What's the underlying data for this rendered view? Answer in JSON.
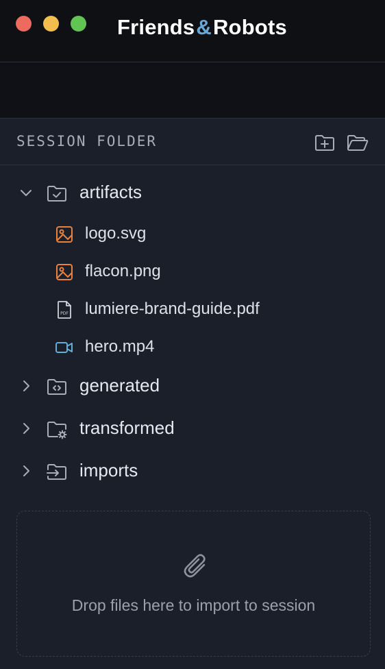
{
  "app": {
    "brand_left": "Friends",
    "brand_amp": "&",
    "brand_right": "Robots",
    "colors": {
      "accent_amp": "#6aa7d9",
      "image_icon": "#e8823d",
      "video_icon": "#5fb0d8"
    }
  },
  "section": {
    "title": "SESSION FOLDER",
    "new_folder_icon": "folder-plus-icon",
    "open_folder_icon": "folder-open-icon"
  },
  "tree": {
    "folders": [
      {
        "label": "artifacts",
        "expanded": true,
        "icon": "folder-check-icon"
      },
      {
        "label": "generated",
        "expanded": false,
        "icon": "folder-code-icon"
      },
      {
        "label": "transformed",
        "expanded": false,
        "icon": "folder-gear-icon"
      },
      {
        "label": "imports",
        "expanded": false,
        "icon": "folder-import-icon"
      }
    ],
    "artifact_files": [
      {
        "label": "logo.svg",
        "icon": "image-icon"
      },
      {
        "label": "flacon.png",
        "icon": "image-icon"
      },
      {
        "label": "lumiere-brand-guide.pdf",
        "icon": "pdf-file-icon"
      },
      {
        "label": "hero.mp4",
        "icon": "video-icon"
      }
    ]
  },
  "dropzone": {
    "icon": "paperclip-icon",
    "text": "Drop files here to import to session"
  }
}
